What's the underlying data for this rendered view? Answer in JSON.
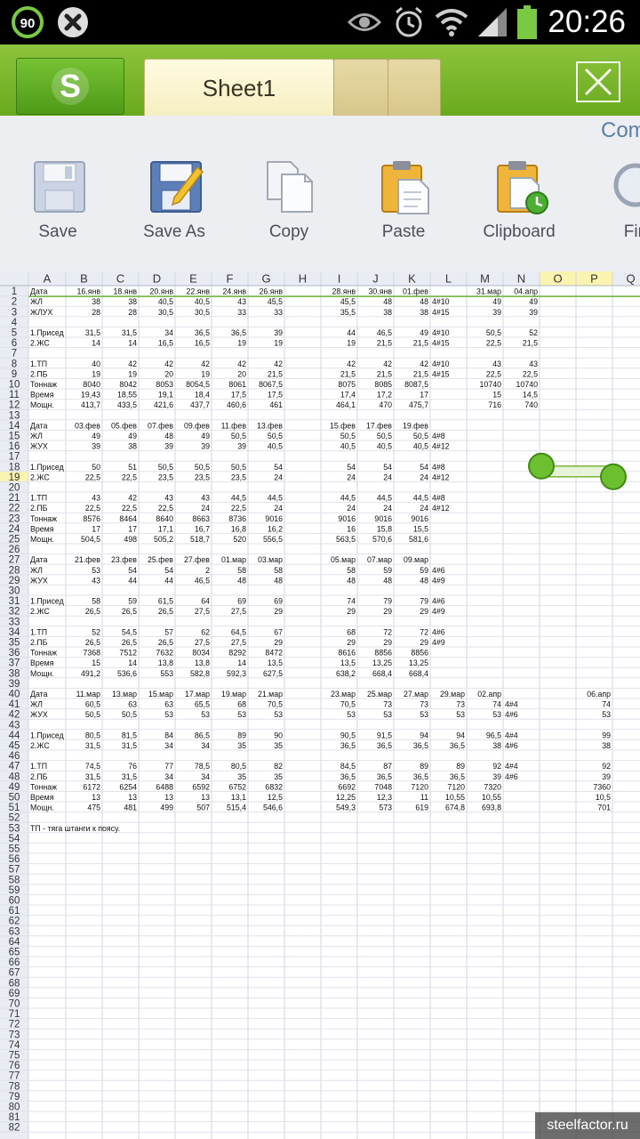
{
  "status_bar": {
    "battery_badge": "90",
    "time": "20:26",
    "icons": [
      "battery-saver-icon",
      "close-notification-icon",
      "eye-icon",
      "alarm-icon",
      "wifi-icon",
      "signal-icon",
      "battery-icon"
    ]
  },
  "app_bar": {
    "logo_letter": "S",
    "active_tab": "Sheet1",
    "colors": {
      "bar": "#7ab62e",
      "tab": "#f8f1c9"
    }
  },
  "toolbar": {
    "partial_right_label": "Com",
    "items": [
      {
        "name": "save",
        "label": "Save",
        "icon": "floppy-disk-icon"
      },
      {
        "name": "save-as",
        "label": "Save As",
        "icon": "floppy-pencil-icon"
      },
      {
        "name": "copy",
        "label": "Copy",
        "icon": "copy-pages-icon"
      },
      {
        "name": "paste",
        "label": "Paste",
        "icon": "clipboard-paste-icon"
      },
      {
        "name": "clipboard",
        "label": "Clipboard",
        "icon": "clipboard-clock-icon"
      },
      {
        "name": "find",
        "label": "Fin",
        "icon": "magnifier-icon"
      }
    ]
  },
  "sheet": {
    "columns": [
      "A",
      "B",
      "C",
      "D",
      "E",
      "F",
      "G",
      "H",
      "I",
      "J",
      "K",
      "L",
      "M",
      "N",
      "O",
      "P",
      "Q"
    ],
    "selected_row": 19,
    "row_count": 82,
    "cells": {
      "1": [
        "Дата",
        "16.янв",
        "18.янв",
        "20.янв",
        "22.янв",
        "24.янв",
        "26.янв",
        "",
        "28.янв",
        "30.янв",
        "01.фев",
        "",
        "31.мар",
        "04.апр",
        "",
        "",
        ""
      ],
      "2": [
        "ЖЛ",
        "38",
        "38",
        "40,5",
        "40,5",
        "43",
        "45,5",
        "",
        "45,5",
        "48",
        "48",
        "4#10",
        "49",
        "49",
        "",
        "",
        ""
      ],
      "3": [
        "ЖЛУХ",
        "28",
        "28",
        "30,5",
        "30,5",
        "33",
        "33",
        "",
        "35,5",
        "38",
        "38",
        "4#15",
        "39",
        "39",
        "",
        "",
        ""
      ],
      "5": [
        "1.Присед",
        "31,5",
        "31,5",
        "34",
        "36,5",
        "36,5",
        "39",
        "",
        "44",
        "46,5",
        "49",
        "4#10",
        "50,5",
        "52",
        "",
        "",
        ""
      ],
      "6": [
        "2.ЖС",
        "14",
        "14",
        "16,5",
        "16,5",
        "19",
        "19",
        "",
        "19",
        "21,5",
        "21,5",
        "4#15",
        "22,5",
        "21,5",
        "",
        "",
        ""
      ],
      "8": [
        "1.ТП",
        "40",
        "42",
        "42",
        "42",
        "42",
        "42",
        "",
        "42",
        "42",
        "42",
        "4#10",
        "43",
        "43",
        "",
        "",
        ""
      ],
      "9": [
        "2.ПБ",
        "19",
        "19",
        "20",
        "19",
        "20",
        "21,5",
        "",
        "21,5",
        "21,5",
        "21,5",
        "4#15",
        "22,5",
        "22,5",
        "",
        "",
        ""
      ],
      "10": [
        "Тоннаж",
        "8040",
        "8042",
        "8053",
        "8054,5",
        "8061",
        "8067,5",
        "",
        "8075",
        "8085",
        "8087,5",
        "",
        "10740",
        "10740",
        "",
        "",
        ""
      ],
      "11": [
        "Время",
        "19,43",
        "18,55",
        "19,1",
        "18,4",
        "17,5",
        "17,5",
        "",
        "17,4",
        "17,2",
        "17",
        "",
        "15",
        "14,5",
        "",
        "",
        ""
      ],
      "12": [
        "Мощн.",
        "413,7",
        "433,5",
        "421,6",
        "437,7",
        "460,6",
        "461",
        "",
        "464,1",
        "470",
        "475,7",
        "",
        "716",
        "740",
        "",
        "",
        ""
      ],
      "14": [
        "Дата",
        "03.фев",
        "05.фев",
        "07.фев",
        "09.фев",
        "11.фев",
        "13.фев",
        "",
        "15.фев",
        "17.фев",
        "19.фев",
        "",
        "",
        "",
        "",
        "",
        ""
      ],
      "15": [
        "ЖЛ",
        "49",
        "49",
        "48",
        "49",
        "50,5",
        "50,5",
        "",
        "50,5",
        "50,5",
        "50,5",
        "4#8",
        "",
        "",
        "",
        "",
        ""
      ],
      "16": [
        "ЖУХ",
        "39",
        "38",
        "39",
        "39",
        "39",
        "40,5",
        "",
        "40,5",
        "40,5",
        "40,5",
        "4#12",
        "",
        "",
        "",
        "",
        ""
      ],
      "18": [
        "1.Присед",
        "50",
        "51",
        "50,5",
        "50,5",
        "50,5",
        "54",
        "",
        "54",
        "54",
        "54",
        "4#8",
        "",
        "",
        "",
        "",
        ""
      ],
      "19": [
        "2.ЖС",
        "22,5",
        "22,5",
        "23,5",
        "23,5",
        "23,5",
        "24",
        "",
        "24",
        "24",
        "24",
        "4#12",
        "",
        "",
        "",
        "",
        ""
      ],
      "21": [
        "1.ТП",
        "43",
        "42",
        "43",
        "43",
        "44,5",
        "44,5",
        "",
        "44,5",
        "44,5",
        "44,5",
        "4#8",
        "",
        "",
        "",
        "",
        ""
      ],
      "22": [
        "2.ПБ",
        "22,5",
        "22,5",
        "22,5",
        "24",
        "22,5",
        "24",
        "",
        "24",
        "24",
        "24",
        "4#12",
        "",
        "",
        "",
        "",
        ""
      ],
      "23": [
        "Тоннаж",
        "8576",
        "8464",
        "8640",
        "8663",
        "8736",
        "9016",
        "",
        "9016",
        "9016",
        "9016",
        "",
        "",
        "",
        "",
        "",
        ""
      ],
      "24": [
        "Время",
        "17",
        "17",
        "17,1",
        "16,7",
        "16,8",
        "16,2",
        "",
        "16",
        "15,8",
        "15,5",
        "",
        "",
        "",
        "",
        "",
        ""
      ],
      "25": [
        "Мощн.",
        "504,5",
        "498",
        "505,2",
        "518,7",
        "520",
        "556,5",
        "",
        "563,5",
        "570,6",
        "581,6",
        "",
        "",
        "",
        "",
        "",
        ""
      ],
      "27": [
        "Дата",
        "21.фев",
        "23.фев",
        "25.фев",
        "27.фев",
        "01.мар",
        "03.мар",
        "",
        "05.мар",
        "07.мар",
        "09.мар",
        "",
        "",
        "",
        "",
        "",
        ""
      ],
      "28": [
        "ЖЛ",
        "53",
        "54",
        "54",
        "2",
        "58",
        "58",
        "",
        "58",
        "59",
        "59",
        "4#6",
        "",
        "",
        "",
        "",
        ""
      ],
      "29": [
        "ЖУХ",
        "43",
        "44",
        "44",
        "46,5",
        "48",
        "48",
        "",
        "48",
        "48",
        "48",
        "4#9",
        "",
        "",
        "",
        "",
        ""
      ],
      "31": [
        "1.Присед",
        "58",
        "59",
        "61,5",
        "64",
        "69",
        "69",
        "",
        "74",
        "79",
        "79",
        "4#6",
        "",
        "",
        "",
        "",
        ""
      ],
      "32": [
        "2.ЖС",
        "26,5",
        "26,5",
        "26,5",
        "27,5",
        "27,5",
        "29",
        "",
        "29",
        "29",
        "29",
        "4#9",
        "",
        "",
        "",
        "",
        ""
      ],
      "34": [
        "1.ТП",
        "52",
        "54,5",
        "57",
        "62",
        "64,5",
        "67",
        "",
        "68",
        "72",
        "72",
        "4#6",
        "",
        "",
        "",
        "",
        ""
      ],
      "35": [
        "2.ПБ",
        "26,5",
        "26,5",
        "26,5",
        "27,5",
        "27,5",
        "29",
        "",
        "29",
        "29",
        "29",
        "4#9",
        "",
        "",
        "",
        "",
        ""
      ],
      "36": [
        "Тоннаж",
        "7368",
        "7512",
        "7632",
        "8034",
        "8292",
        "8472",
        "",
        "8616",
        "8856",
        "8856",
        "",
        "",
        "",
        "",
        "",
        ""
      ],
      "37": [
        "Время",
        "15",
        "14",
        "13,8",
        "13,8",
        "14",
        "13,5",
        "",
        "13,5",
        "13,25",
        "13,25",
        "",
        "",
        "",
        "",
        "",
        ""
      ],
      "38": [
        "Мощн.",
        "491,2",
        "536,6",
        "553",
        "582,8",
        "592,3",
        "627,5",
        "",
        "638,2",
        "668,4",
        "668,4",
        "",
        "",
        "",
        "",
        "",
        ""
      ],
      "40": [
        "Дата",
        "11.мар",
        "13.мар",
        "15.мар",
        "17.мар",
        "19.мар",
        "21.мар",
        "",
        "23.мар",
        "25.мар",
        "27.мар",
        "29.мар",
        "02.апр",
        "",
        "",
        "06.апр",
        ""
      ],
      "41": [
        "ЖЛ",
        "60,5",
        "63",
        "63",
        "65,5",
        "68",
        "70,5",
        "",
        "70,5",
        "73",
        "73",
        "73",
        "74",
        "4#4",
        "",
        "74",
        ""
      ],
      "42": [
        "ЖУХ",
        "50,5",
        "50,5",
        "53",
        "53",
        "53",
        "53",
        "",
        "53",
        "53",
        "53",
        "53",
        "53",
        "4#6",
        "",
        "53",
        ""
      ],
      "44": [
        "1.Присед",
        "80,5",
        "81,5",
        "84",
        "86,5",
        "89",
        "90",
        "",
        "90,5",
        "91,5",
        "94",
        "94",
        "96,5",
        "4#4",
        "",
        "99",
        ""
      ],
      "45": [
        "2.ЖС",
        "31,5",
        "31,5",
        "34",
        "34",
        "35",
        "35",
        "",
        "36,5",
        "36,5",
        "36,5",
        "36,5",
        "38",
        "4#6",
        "",
        "38",
        ""
      ],
      "47": [
        "1.ТП",
        "74,5",
        "76",
        "77",
        "78,5",
        "80,5",
        "82",
        "",
        "84,5",
        "87",
        "89",
        "89",
        "92",
        "4#4",
        "",
        "92",
        ""
      ],
      "48": [
        "2.ПБ",
        "31,5",
        "31,5",
        "34",
        "34",
        "35",
        "35",
        "",
        "36,5",
        "36,5",
        "36,5",
        "36,5",
        "39",
        "4#6",
        "",
        "39",
        ""
      ],
      "49": [
        "Тоннаж",
        "6172",
        "6254",
        "6488",
        "6592",
        "6752",
        "6832",
        "",
        "6692",
        "7048",
        "7120",
        "7120",
        "7320",
        "",
        "",
        "7360",
        ""
      ],
      "50": [
        "Время",
        "13",
        "13",
        "13",
        "13",
        "13,1",
        "12,5",
        "",
        "12,25",
        "12,3",
        "11",
        "10,55",
        "10,55",
        "",
        "",
        "10,5",
        ""
      ],
      "51": [
        "Мощн.",
        "475",
        "481",
        "499",
        "507",
        "515,4",
        "546,6",
        "",
        "549,3",
        "573",
        "619",
        "674,8",
        "693,8",
        "",
        "",
        "701",
        ""
      ],
      "53": [
        "ТП - тяга штанги к поясу.",
        "",
        "",
        "",
        "",
        "",
        "",
        "",
        "",
        "",
        "",
        "",
        "",
        "",
        "",
        "",
        ""
      ]
    }
  },
  "watermark": "steelfactor.ru"
}
